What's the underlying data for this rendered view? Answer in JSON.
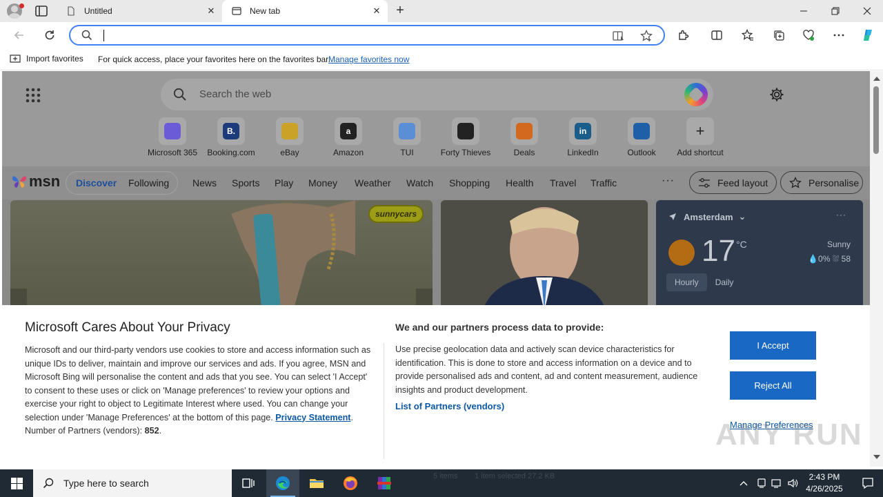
{
  "browser": {
    "tabs": [
      {
        "label": "Untitled",
        "active": false
      },
      {
        "label": "New tab",
        "active": true
      }
    ],
    "close_glyph": "✕",
    "new_tab_glyph": "+",
    "address": {
      "value": "",
      "placeholder": ""
    }
  },
  "favorites_bar": {
    "import_label": "Import favorites",
    "message": "For quick access, place your favorites here on the favorites bar.",
    "manage_link": "Manage favorites now"
  },
  "ntp": {
    "search_placeholder": "Search the web",
    "shortcuts": [
      {
        "label": "Microsoft 365",
        "glyph": "",
        "color": "#6b5bd6"
      },
      {
        "label": "Booking.com",
        "glyph": "B.",
        "color": "#1d3a7a"
      },
      {
        "label": "eBay",
        "glyph": "",
        "color": "#c9a227"
      },
      {
        "label": "Amazon",
        "glyph": "a",
        "color": "#222222"
      },
      {
        "label": "TUI",
        "glyph": "",
        "color": "#5a8fd6"
      },
      {
        "label": "Forty Thieves",
        "glyph": "",
        "color": "#222222"
      },
      {
        "label": "Deals",
        "glyph": "",
        "color": "#d2691e"
      },
      {
        "label": "LinkedIn",
        "glyph": "in",
        "color": "#1a5c8a"
      },
      {
        "label": "Outlook",
        "glyph": "",
        "color": "#1f5fa8"
      },
      {
        "label": "Add shortcut",
        "glyph": "+",
        "color": "transparent"
      }
    ]
  },
  "msn": {
    "logo": "msn",
    "segment": [
      "Discover",
      "Following"
    ],
    "nav": [
      "News",
      "Sports",
      "Play",
      "Money",
      "Weather",
      "Watch",
      "Shopping",
      "Health",
      "Travel",
      "Traffic"
    ],
    "more": "···",
    "feed_layout": "Feed layout",
    "personalise": "Personalise",
    "hero_badge": "sunnycars",
    "weather": {
      "location": "Amsterdam",
      "more": "···",
      "temp": "17",
      "unit": "°C",
      "condition": "Sunny",
      "stats": "💧0%  ⛆ 58",
      "tabs": [
        "Hourly",
        "Daily"
      ]
    }
  },
  "privacy": {
    "title": "Microsoft Cares About Your Privacy",
    "body": "Microsoft and our third-party vendors use cookies to store and access information such as unique IDs to deliver, maintain and improve our services and ads. If you agree, MSN and Microsoft Bing will personalise the content and ads that you see. You can select 'I Accept' to consent to these uses or click on 'Manage preferences' to review your options and exercise your right to object to Legitimate Interest where used.  You can change your selection under 'Manage Preferences' at the bottom of this page.",
    "privacy_link": "Privacy Statement",
    "partners_count_label": "Number of Partners (vendors):",
    "partners_count": "852",
    "subtitle": "We and our partners process data to provide:",
    "purpose": "Use precise geolocation data and actively scan device characteristics for identification. This is done to store and access information on a device and to provide personalised ads and content, ad and content measurement, audience insights and product development.",
    "partners_link": "List of Partners (vendors)",
    "accept": "I Accept",
    "reject": "Reject All",
    "manage": "Manage Preferences"
  },
  "watermark": "ANY RUN",
  "taskbar": {
    "search_placeholder": "Type here to search",
    "ghost_left": "5 items",
    "ghost_right": "1 item selected  27.2 KB",
    "time": "2:43 PM",
    "date": "4/26/2025"
  },
  "colors": {
    "accent": "#1868c4",
    "link": "#0b58a6",
    "omnibox_focus": "#3f81f5",
    "taskbar": "#1f2a35"
  }
}
